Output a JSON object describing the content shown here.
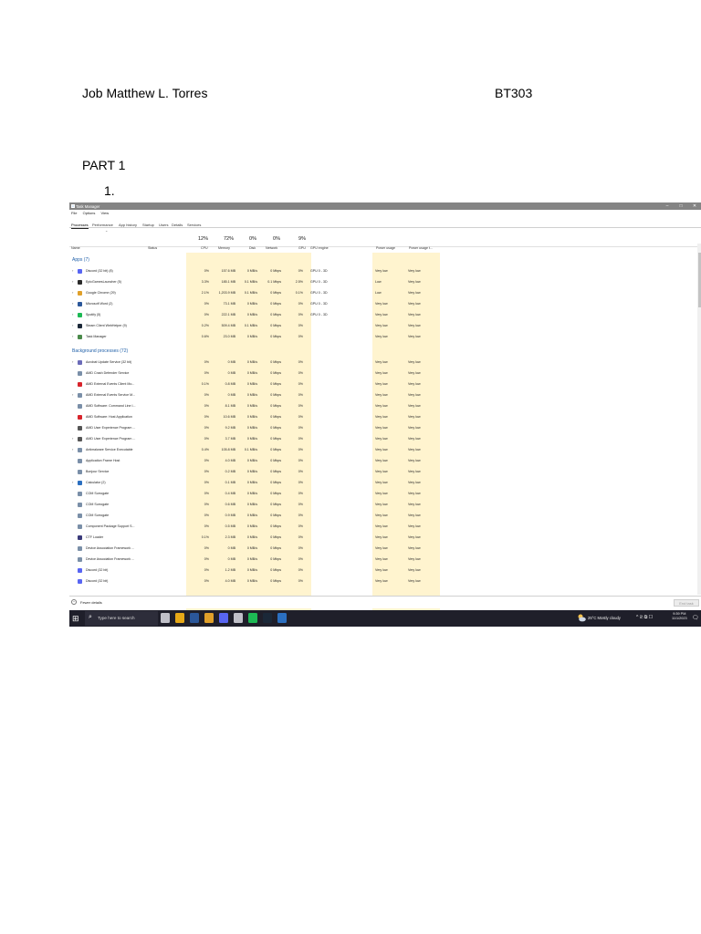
{
  "document": {
    "author": "Job Matthew L. Torres",
    "course": "BT303",
    "part_heading": "PART 1",
    "item_number": "1."
  },
  "task_manager": {
    "window_title": "Task Manager",
    "window_controls": [
      "–",
      "□",
      "✕"
    ],
    "menu": [
      "File",
      "Options",
      "View"
    ],
    "tabs": [
      "Processes",
      "Performance",
      "App history",
      "Startup",
      "Users",
      "Details",
      "Services"
    ],
    "active_tab": "Processes",
    "percent_headers": {
      "cpu": "12%",
      "memory": "72%",
      "disk": "0%",
      "network": "0%",
      "gpu": "9%"
    },
    "column_headers": {
      "name": "Name",
      "status": "Status",
      "cpu": "CPU",
      "memory": "Memory",
      "disk": "Disk",
      "network": "Network",
      "gpu": "GPU",
      "gpu_engine": "GPU engine",
      "power_usage": "Power usage",
      "power_usage_trend": "Power usage t..."
    },
    "apps_group": "Apps (7)",
    "apps": [
      {
        "name": "Discord (32 bit) (8)",
        "cpu": "0%",
        "memory": "157.6 MB",
        "disk": "0 MB/s",
        "network": "0 Mbps",
        "gpu": "0%",
        "gpu_engine": "GPU 0 - 3D",
        "power": "Very low",
        "trend": "Very low",
        "icon_color": "#5865f2"
      },
      {
        "name": "EpicGamesLauncher (5)",
        "cpu": "3.3%",
        "memory": "185.1 MB",
        "disk": "0.1 MB/s",
        "network": "0.1 Mbps",
        "gpu": "2.5%",
        "gpu_engine": "GPU 0 - 3D",
        "power": "Low",
        "trend": "Very low",
        "icon_color": "#2a2a2a"
      },
      {
        "name": "Google Chrome (29)",
        "cpu": "2.1%",
        "memory": "1,203.9 MB",
        "disk": "0.1 MB/s",
        "network": "0 Mbps",
        "gpu": "0.1%",
        "gpu_engine": "GPU 0 - 3D",
        "power": "Low",
        "trend": "Very low",
        "icon_color": "#e0a02a"
      },
      {
        "name": "Microsoft Word (2)",
        "cpu": "0%",
        "memory": "73.1 MB",
        "disk": "0 MB/s",
        "network": "0 Mbps",
        "gpu": "0%",
        "gpu_engine": "GPU 0 - 3D",
        "power": "Very low",
        "trend": "Very low",
        "icon_color": "#2b579a"
      },
      {
        "name": "Spotify (5)",
        "cpu": "0%",
        "memory": "222.1 MB",
        "disk": "0 MB/s",
        "network": "0 Mbps",
        "gpu": "0%",
        "gpu_engine": "GPU 0 - 3D",
        "power": "Very low",
        "trend": "Very low",
        "icon_color": "#1db954"
      },
      {
        "name": "Steam Client WebHelper (9)",
        "cpu": "0.2%",
        "memory": "509.4 MB",
        "disk": "0.1 MB/s",
        "network": "0 Mbps",
        "gpu": "0%",
        "gpu_engine": "",
        "power": "Very low",
        "trend": "Very low",
        "icon_color": "#1b2838"
      },
      {
        "name": "Task Manager",
        "cpu": "0.6%",
        "memory": "23.0 MB",
        "disk": "0 MB/s",
        "network": "0 Mbps",
        "gpu": "0%",
        "gpu_engine": "",
        "power": "Very low",
        "trend": "Very low",
        "icon_color": "#4a8a4a"
      }
    ],
    "bg_group": "Background processes (72)",
    "background": [
      {
        "name": "Acrobat Update Service (32 bit)",
        "cpu": "0%",
        "memory": "0 MB",
        "disk": "0 MB/s",
        "network": "0 Mbps",
        "gpu": "0%",
        "power": "Very low",
        "trend": "Very low",
        "icon_color": "#6b6bb8"
      },
      {
        "name": "AMD Crash Defender Service",
        "cpu": "0%",
        "memory": "0 MB",
        "disk": "0 MB/s",
        "network": "0 Mbps",
        "gpu": "0%",
        "power": "Very low",
        "trend": "Very low",
        "icon_color": "#7a8fa8"
      },
      {
        "name": "AMD External Events Client Mo...",
        "cpu": "0.1%",
        "memory": "0.8 MB",
        "disk": "0 MB/s",
        "network": "0 Mbps",
        "gpu": "0%",
        "power": "Very low",
        "trend": "Very low",
        "icon_color": "#d8242c"
      },
      {
        "name": "AMD External Events Service M...",
        "cpu": "0%",
        "memory": "0 MB",
        "disk": "0 MB/s",
        "network": "0 Mbps",
        "gpu": "0%",
        "power": "Very low",
        "trend": "Very low",
        "icon_color": "#7a8fa8"
      },
      {
        "name": "AMD Software: Command Line I...",
        "cpu": "0%",
        "memory": "8.1 MB",
        "disk": "0 MB/s",
        "network": "0 Mbps",
        "gpu": "0%",
        "power": "Very low",
        "trend": "Very low",
        "icon_color": "#7a8fa8"
      },
      {
        "name": "AMD Software: Host Application",
        "cpu": "0%",
        "memory": "10.6 MB",
        "disk": "0 MB/s",
        "network": "0 Mbps",
        "gpu": "0%",
        "power": "Very low",
        "trend": "Very low",
        "icon_color": "#d8242c"
      },
      {
        "name": "AMD User Experience Program ...",
        "cpu": "0%",
        "memory": "9.2 MB",
        "disk": "0 MB/s",
        "network": "0 Mbps",
        "gpu": "0%",
        "power": "Very low",
        "trend": "Very low",
        "icon_color": "#555555"
      },
      {
        "name": "AMD User Experience Program ...",
        "cpu": "0%",
        "memory": "3.7 MB",
        "disk": "0 MB/s",
        "network": "0 Mbps",
        "gpu": "0%",
        "power": "Very low",
        "trend": "Very low",
        "icon_color": "#555555"
      },
      {
        "name": "Antimalware Service Executable",
        "cpu": "0.4%",
        "memory": "105.8 MB",
        "disk": "0.1 MB/s",
        "network": "0 Mbps",
        "gpu": "0%",
        "power": "Very low",
        "trend": "Very low",
        "icon_color": "#7a8fa8"
      },
      {
        "name": "Application Frame Host",
        "cpu": "0%",
        "memory": "4.0 MB",
        "disk": "0 MB/s",
        "network": "0 Mbps",
        "gpu": "0%",
        "power": "Very low",
        "trend": "Very low",
        "icon_color": "#7a8fa8"
      },
      {
        "name": "Bonjour Service",
        "cpu": "0%",
        "memory": "0.2 MB",
        "disk": "0 MB/s",
        "network": "0 Mbps",
        "gpu": "0%",
        "power": "Very low",
        "trend": "Very low",
        "icon_color": "#7a8fa8"
      },
      {
        "name": "Calculator (2)",
        "cpu": "0%",
        "memory": "0.1 MB",
        "disk": "0 MB/s",
        "network": "0 Mbps",
        "gpu": "0%",
        "power": "Very low",
        "trend": "Very low",
        "icon_color": "#2b6fc0"
      },
      {
        "name": "COM Surrogate",
        "cpu": "0%",
        "memory": "0.4 MB",
        "disk": "0 MB/s",
        "network": "0 Mbps",
        "gpu": "0%",
        "power": "Very low",
        "trend": "Very low",
        "icon_color": "#7a8fa8"
      },
      {
        "name": "COM Surrogate",
        "cpu": "0%",
        "memory": "0.6 MB",
        "disk": "0 MB/s",
        "network": "0 Mbps",
        "gpu": "0%",
        "power": "Very low",
        "trend": "Very low",
        "icon_color": "#7a8fa8"
      },
      {
        "name": "COM Surrogate",
        "cpu": "0%",
        "memory": "0.9 MB",
        "disk": "0 MB/s",
        "network": "0 Mbps",
        "gpu": "0%",
        "power": "Very low",
        "trend": "Very low",
        "icon_color": "#7a8fa8"
      },
      {
        "name": "Component Package Support S...",
        "cpu": "0%",
        "memory": "0.5 MB",
        "disk": "0 MB/s",
        "network": "0 Mbps",
        "gpu": "0%",
        "power": "Very low",
        "trend": "Very low",
        "icon_color": "#7a8fa8"
      },
      {
        "name": "CTF Loader",
        "cpu": "0.1%",
        "memory": "2.3 MB",
        "disk": "0 MB/s",
        "network": "0 Mbps",
        "gpu": "0%",
        "power": "Very low",
        "trend": "Very low",
        "icon_color": "#3a3a7a"
      },
      {
        "name": "Device Association Framework ...",
        "cpu": "0%",
        "memory": "0 MB",
        "disk": "0 MB/s",
        "network": "0 Mbps",
        "gpu": "0%",
        "power": "Very low",
        "trend": "Very low",
        "icon_color": "#7a8fa8"
      },
      {
        "name": "Device Association Framework ...",
        "cpu": "0%",
        "memory": "0 MB",
        "disk": "0 MB/s",
        "network": "0 Mbps",
        "gpu": "0%",
        "power": "Very low",
        "trend": "Very low",
        "icon_color": "#7a8fa8"
      },
      {
        "name": "Discord (32 bit)",
        "cpu": "0%",
        "memory": "1.2 MB",
        "disk": "0 MB/s",
        "network": "0 Mbps",
        "gpu": "0%",
        "power": "Very low",
        "trend": "Very low",
        "icon_color": "#5865f2"
      },
      {
        "name": "Discord (32 bit)",
        "cpu": "0%",
        "memory": "4.0 MB",
        "disk": "0 MB/s",
        "network": "0 Mbps",
        "gpu": "0%",
        "power": "Very low",
        "trend": "Very low",
        "icon_color": "#5865f2"
      }
    ],
    "footer": {
      "fewer_details": "Fewer details",
      "end_task": "End task"
    }
  },
  "taskbar": {
    "search_placeholder": "Type here to search",
    "weather": "25°C  Mostly cloudy",
    "tray_icons": "^ 🗈 ⧉ ☐",
    "time": "9:39 PM",
    "date": "11/1/2023",
    "pinned_app_colors": [
      "#c0c0c8",
      "#e6a817",
      "#2b579a",
      "#e0a02a",
      "#5865f2",
      "#c0c0c8",
      "#1db954",
      "#1b2838",
      "#2b6fc0"
    ]
  }
}
